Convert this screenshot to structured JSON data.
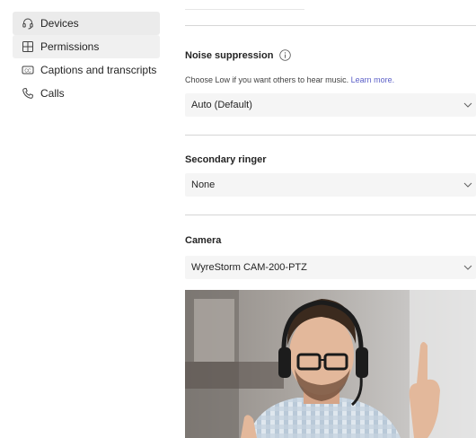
{
  "sidebar": {
    "items": [
      {
        "label": "Devices",
        "icon": "headset-icon",
        "state": "active"
      },
      {
        "label": "Permissions",
        "icon": "permissions-icon",
        "state": "hover"
      },
      {
        "label": "Captions and transcripts",
        "icon": "captions-icon",
        "state": ""
      },
      {
        "label": "Calls",
        "icon": "phone-icon",
        "state": ""
      }
    ]
  },
  "noise": {
    "title": "Noise suppression",
    "hint": "Choose Low if you want others to hear music.",
    "learn_more": "Learn more.",
    "value": "Auto (Default)"
  },
  "ringer": {
    "title": "Secondary ringer",
    "value": "None"
  },
  "camera": {
    "title": "Camera",
    "value": "WyreStorm CAM-200-PTZ"
  },
  "colors": {
    "accent": "#5b5fc7",
    "dropdown_bg": "#f5f5f5",
    "active_nav_bg": "#ebebeb"
  }
}
